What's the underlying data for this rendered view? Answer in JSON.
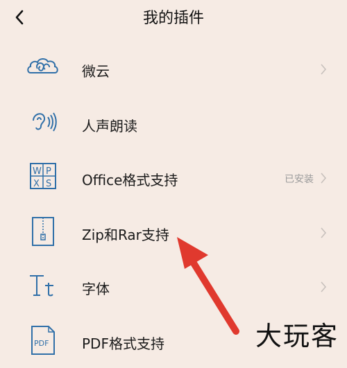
{
  "header": {
    "title": "我的插件",
    "back_icon": "chevron-left-icon"
  },
  "plugins": [
    {
      "label": "微云",
      "icon": "cloud-icon",
      "status": ""
    },
    {
      "label": "人声朗读",
      "icon": "ear-sound-icon",
      "status": ""
    },
    {
      "label": "Office格式支持",
      "icon": "office-wpxs-icon",
      "status": "已安装"
    },
    {
      "label": "Zip和Rar支持",
      "icon": "zip-archive-icon",
      "status": ""
    },
    {
      "label": "字体",
      "icon": "font-tt-icon",
      "status": ""
    },
    {
      "label": "PDF格式支持",
      "icon": "pdf-file-icon",
      "status": ""
    }
  ],
  "annotation": {
    "arrow_color": "#e0392e"
  },
  "watermark": "大玩客",
  "colors": {
    "background": "#f6ebe4",
    "icon_blue": "#2f6fa8"
  }
}
